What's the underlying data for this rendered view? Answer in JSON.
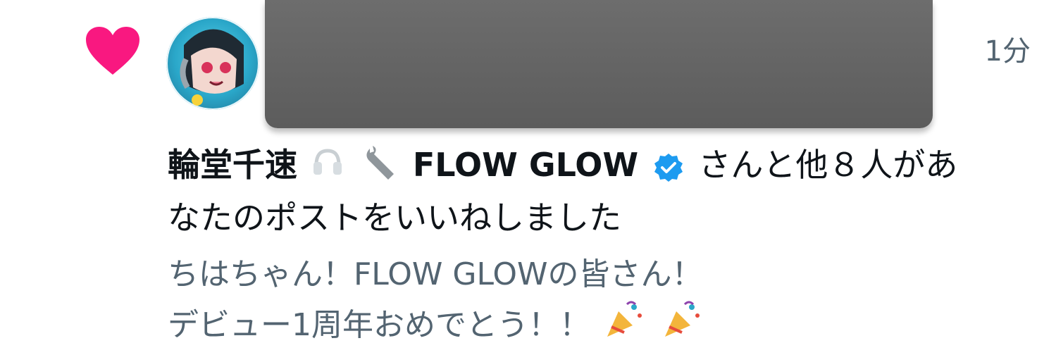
{
  "notification": {
    "type_icon": "heart-icon",
    "heart_color": "#f91880",
    "timestamp": "1分",
    "liker_name": "輪堂千速",
    "liker_emojis": [
      "headphones",
      "wrench"
    ],
    "group_name": "FLOW GLOW",
    "verified_color": "#1d9bf0",
    "message_after_name": "さんと他８人があ",
    "message_line2": "なたのポストをいいねしました",
    "quoted_line1": "ちはちゃん！FLOW GLOWの皆さん！",
    "quoted_line2": "デビュー1周年おめでとう！！",
    "quoted_emojis": [
      "party-popper",
      "party-popper"
    ]
  }
}
